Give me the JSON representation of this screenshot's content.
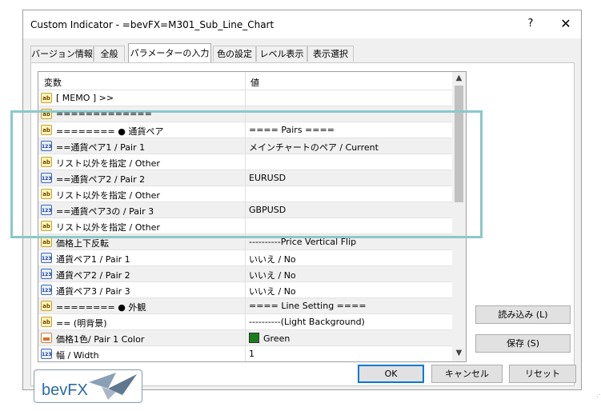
{
  "window": {
    "title": "Custom Indicator - =bevFX=M301_Sub_Line_Chart",
    "help_glyph": "?",
    "close_glyph": "✕"
  },
  "tabs": [
    {
      "label": "バージョン情報"
    },
    {
      "label": "全般"
    },
    {
      "label": "パラメーターの入力",
      "active": true
    },
    {
      "label": "色の設定"
    },
    {
      "label": "レベル表示"
    },
    {
      "label": "表示選択"
    }
  ],
  "grid": {
    "col_variable": "変数",
    "col_value": "値",
    "rows": [
      {
        "icon": "ab",
        "name": "[ MEMO ] >>",
        "value": ""
      },
      {
        "icon": "ab",
        "name": "=============",
        "value": ""
      },
      {
        "icon": "ab",
        "name": "========   ● 通貨ペア",
        "value": "==== Pairs  ===="
      },
      {
        "icon": "123",
        "name": "==通貨ペア1 / Pair 1",
        "value": "メインチャートのペア / Current"
      },
      {
        "icon": "ab",
        "name": "      リスト以外を指定  / Other",
        "value": ""
      },
      {
        "icon": "123",
        "name": "==通貨ペア2 / Pair 2",
        "value": "EURUSD"
      },
      {
        "icon": "ab",
        "name": "      リスト以外を指定 / Other",
        "value": ""
      },
      {
        "icon": "123",
        "name": "==通貨ペア3の / Pair 3",
        "value": "GBPUSD"
      },
      {
        "icon": "ab",
        "name": "      リスト以外を指定 / Other",
        "value": ""
      },
      {
        "icon": "ab",
        "name": "    価格上下反転",
        "value": "----------Price Vertical Flip"
      },
      {
        "icon": "123",
        "name": "    通貨ペア1 / Pair 1",
        "value": "  いいえ / No"
      },
      {
        "icon": "123",
        "name": "    通貨ペア2 / Pair 2",
        "value": "  いいえ / No"
      },
      {
        "icon": "123",
        "name": "    通貨ペア3 / Pair 3",
        "value": "  いいえ / No"
      },
      {
        "icon": "ab",
        "name": "========   ● 外観",
        "value": "==== Line  Setting  ===="
      },
      {
        "icon": "ab",
        "name": "==       (明背景)",
        "value": "----------(Light Background)"
      },
      {
        "icon": "color",
        "name": "  価格1色/ Pair 1 Color",
        "value": "Green",
        "swatch": "#1a7f1a"
      },
      {
        "icon": "123",
        "name": "    幅 / Width",
        "value": "1"
      }
    ],
    "scroll_up": "▲",
    "scroll_down": "▼"
  },
  "buttons": {
    "load": "読み込み (L)",
    "save": "保存 (S)",
    "ok": "OK",
    "cancel": "キャンセル",
    "reset": "リセット"
  },
  "logo": {
    "text": "bevFX"
  }
}
